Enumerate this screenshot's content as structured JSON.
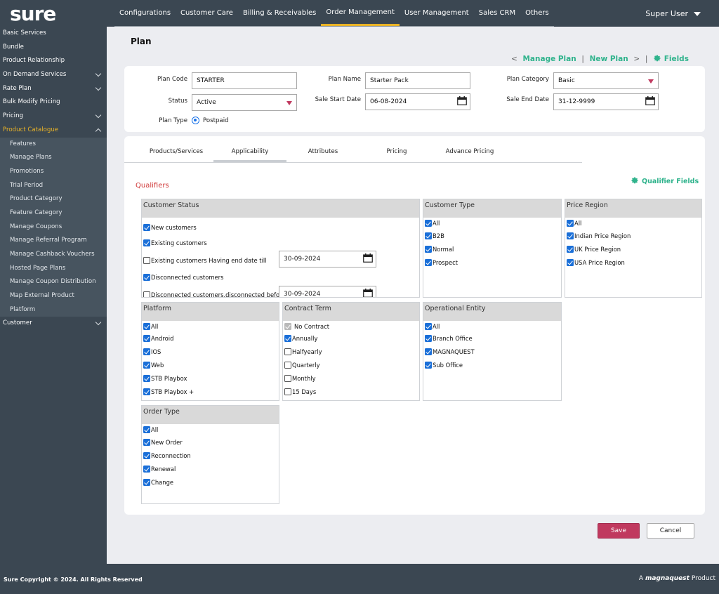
{
  "app": {
    "logo": "sure",
    "user": "Super User"
  },
  "topnav": [
    "Configurations",
    "Customer Care",
    "Billing & Receivables",
    "Order Management",
    "User Management",
    "Sales CRM",
    "Others"
  ],
  "sidebar": {
    "items": [
      "Basic Services",
      "Bundle",
      "Product Relationship",
      "On Demand Services",
      "Rate Plan",
      "Bulk Modify Pricing",
      "Pricing",
      "Product Catalogue"
    ],
    "submenu": [
      "Features",
      "Manage Plans",
      "Promotions",
      "Trial Period",
      "Product Category",
      "Feature Category",
      "Manage Coupons",
      "Manage Referral Program",
      "Manage Cashback Vouchers",
      "Hosted Page Plans",
      "Manage Coupon Distribution",
      "Map External Product",
      "Platform"
    ],
    "last": "Customer"
  },
  "page": {
    "title": "Plan"
  },
  "breadcrumb": {
    "manage_plan": "Manage Plan",
    "new_plan": "New Plan",
    "fields": "Fields",
    "sep": "|",
    "chev_left": "<",
    "chev_right": ">"
  },
  "form": {
    "plan_code_label": "Plan Code",
    "plan_code": "STARTER",
    "plan_name_label": "Plan Name",
    "plan_name": "Starter Pack",
    "plan_category_label": "Plan Category",
    "plan_category": "Basic",
    "status_label": "Status",
    "status": "Active",
    "sale_start_label": "Sale Start Date",
    "sale_start": "06-08-2024",
    "sale_end_label": "Sale End Date",
    "sale_end": "31-12-9999",
    "plan_type_label": "Plan Type",
    "plan_type": "Postpaid"
  },
  "tabs": [
    "Products/Services",
    "Applicability",
    "Attributes",
    "Pricing",
    "Advance Pricing"
  ],
  "qualifiers": {
    "title": "Qualifiers",
    "fields_link": "Qualifier Fields",
    "customer_status": {
      "title": "Customer Status",
      "options": [
        "New customers",
        "Existing customers",
        "Existing customers Having end date till",
        "Disconnected customers",
        "Disconnected customers.disconnected before"
      ],
      "dates": [
        "30-09-2024",
        "30-09-2024"
      ]
    },
    "customer_type": {
      "title": "Customer Type",
      "options": [
        "All",
        "B2B",
        "Normal",
        "Prospect"
      ]
    },
    "price_region": {
      "title": "Price Region",
      "options": [
        "All",
        "Indian Price Region",
        "UK Price Region",
        "USA Price Region"
      ]
    },
    "platform": {
      "title": "Platform",
      "options": [
        "All",
        "Android",
        "IOS",
        "Web",
        "STB Playbox",
        "STB Playbox +"
      ]
    },
    "contract_term": {
      "title": "Contract Term",
      "options": [
        "No Contract",
        "Annually",
        "Halfyearly",
        "Quarterly",
        "Monthly",
        "15 Days"
      ]
    },
    "operational_entity": {
      "title": "Operational Entity",
      "options": [
        "All",
        "Branch Office",
        "MAGNAQUEST",
        "Sub Office"
      ]
    },
    "order_type": {
      "title": "Order Type",
      "options": [
        "All",
        "New Order",
        "Reconnection",
        "Renewal",
        "Change"
      ]
    }
  },
  "buttons": {
    "save": "Save",
    "cancel": "Cancel"
  },
  "footer": {
    "copyright": "Sure Copyright © 2024. All Rights Reserved",
    "brand_prefix": "A",
    "brand_name": "magnaquest",
    "brand_suffix": "Product"
  },
  "colors": {
    "accent": "#2fb38c",
    "nav_bg": "#3b4752",
    "save": "#c0395f",
    "active_menu": "#e8b227"
  }
}
